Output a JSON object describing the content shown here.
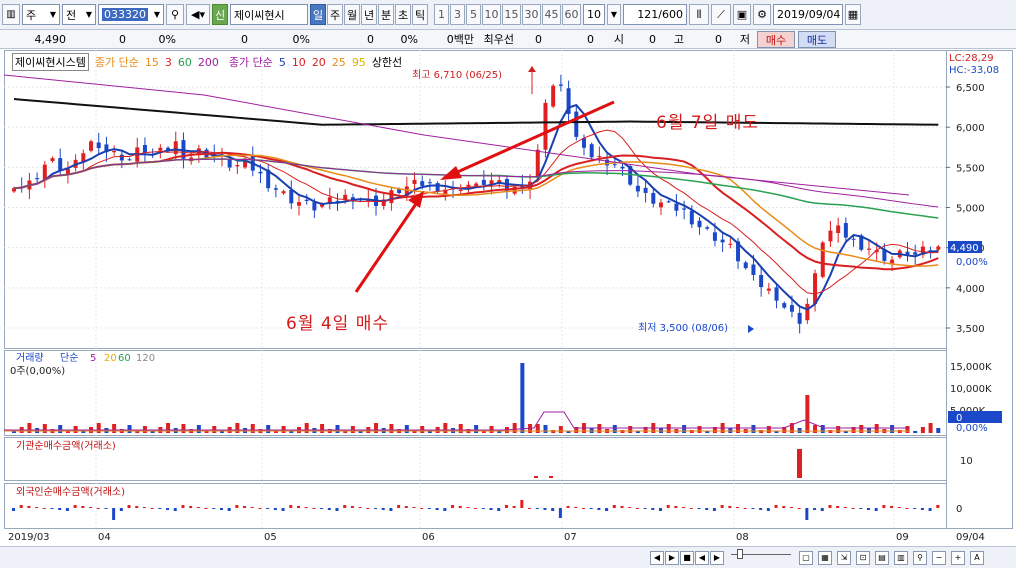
{
  "toolbar": {
    "chart_icon": "chart-window-icon",
    "market_select": "주",
    "period_select": "전",
    "stock_code": "033320",
    "credit_badge": "신",
    "stock_name": "제이씨현시",
    "period_tabs": [
      "일",
      "주",
      "월",
      "년",
      "분",
      "초",
      "틱"
    ],
    "interval_buttons": [
      "1",
      "3",
      "5",
      "10",
      "15",
      "30",
      "45",
      "60"
    ],
    "interval_value": "10",
    "count_value": "121",
    "count_total": "/600",
    "date_value": "2019/09/04"
  },
  "infobar": {
    "price": "4,490",
    "change": "0",
    "change_pct": "0%",
    "volume": "0",
    "volume_pct": "0%",
    "amount": "0",
    "amount_pct": "0%",
    "amount_unit": "0백만",
    "priority_label": "최우선",
    "priority_buy": "0",
    "priority_sell": "0",
    "open_label": "시",
    "open": "0",
    "high_label": "고",
    "high": "0",
    "low_label": "저",
    "low": "0",
    "buy_button": "매수",
    "sell_button": "매도"
  },
  "legend": {
    "company": "제이씨현시스템",
    "ma_close_title": "종가 단순",
    "ma_close_periods": [
      "15",
      "3",
      "60",
      "200"
    ],
    "ma_close_colors": [
      "#e88b1a",
      "#d92020",
      "#2aa050",
      "#a020a0"
    ],
    "ma2_title": "종가 단순",
    "ma2_periods": [
      "5",
      "10",
      "20",
      "25",
      "95"
    ],
    "ma2_colors": [
      "#1a3fb0",
      "#d92020",
      "#d92020",
      "#e88b1a",
      "#e0b000"
    ],
    "upper_limit": "상한선"
  },
  "right_info": {
    "lc": "LC:28,29",
    "hc": "HC:-33,08"
  },
  "price_axis": [
    "6,500",
    "6,000",
    "5,500",
    "5,000",
    "4,500",
    "4,000",
    "3,500"
  ],
  "current_price_label": "4,490",
  "current_pct_label": "0,00%",
  "high_note": "최고 6,710 (06/25)",
  "low_note": "최저 3,500 (08/06)",
  "annotations": {
    "sell": "6월 7일 매도",
    "buy": "6월 4일 매수"
  },
  "volume_panel": {
    "title": "거래량",
    "ma_title": "단순",
    "ma_periods": [
      "5",
      "20",
      "60",
      "120"
    ],
    "status": "0주(0,00%)",
    "axis": [
      "15,000K",
      "10,000K",
      "5,000K",
      "0",
      "0,00%"
    ]
  },
  "inst_panel": {
    "title": "기관순매수금액(거래소)",
    "axis": [
      "10"
    ]
  },
  "foreign_panel": {
    "title": "외국인순매수금액(거래소)",
    "axis": [
      "0"
    ]
  },
  "date_axis": [
    "2019/03",
    "04",
    "05",
    "06",
    "07",
    "08",
    "09",
    "09/04"
  ],
  "colors": {
    "up": "#e02020",
    "down": "#1a48c8",
    "accent": "#4a78c0",
    "annotation": "#d41a1a"
  }
}
